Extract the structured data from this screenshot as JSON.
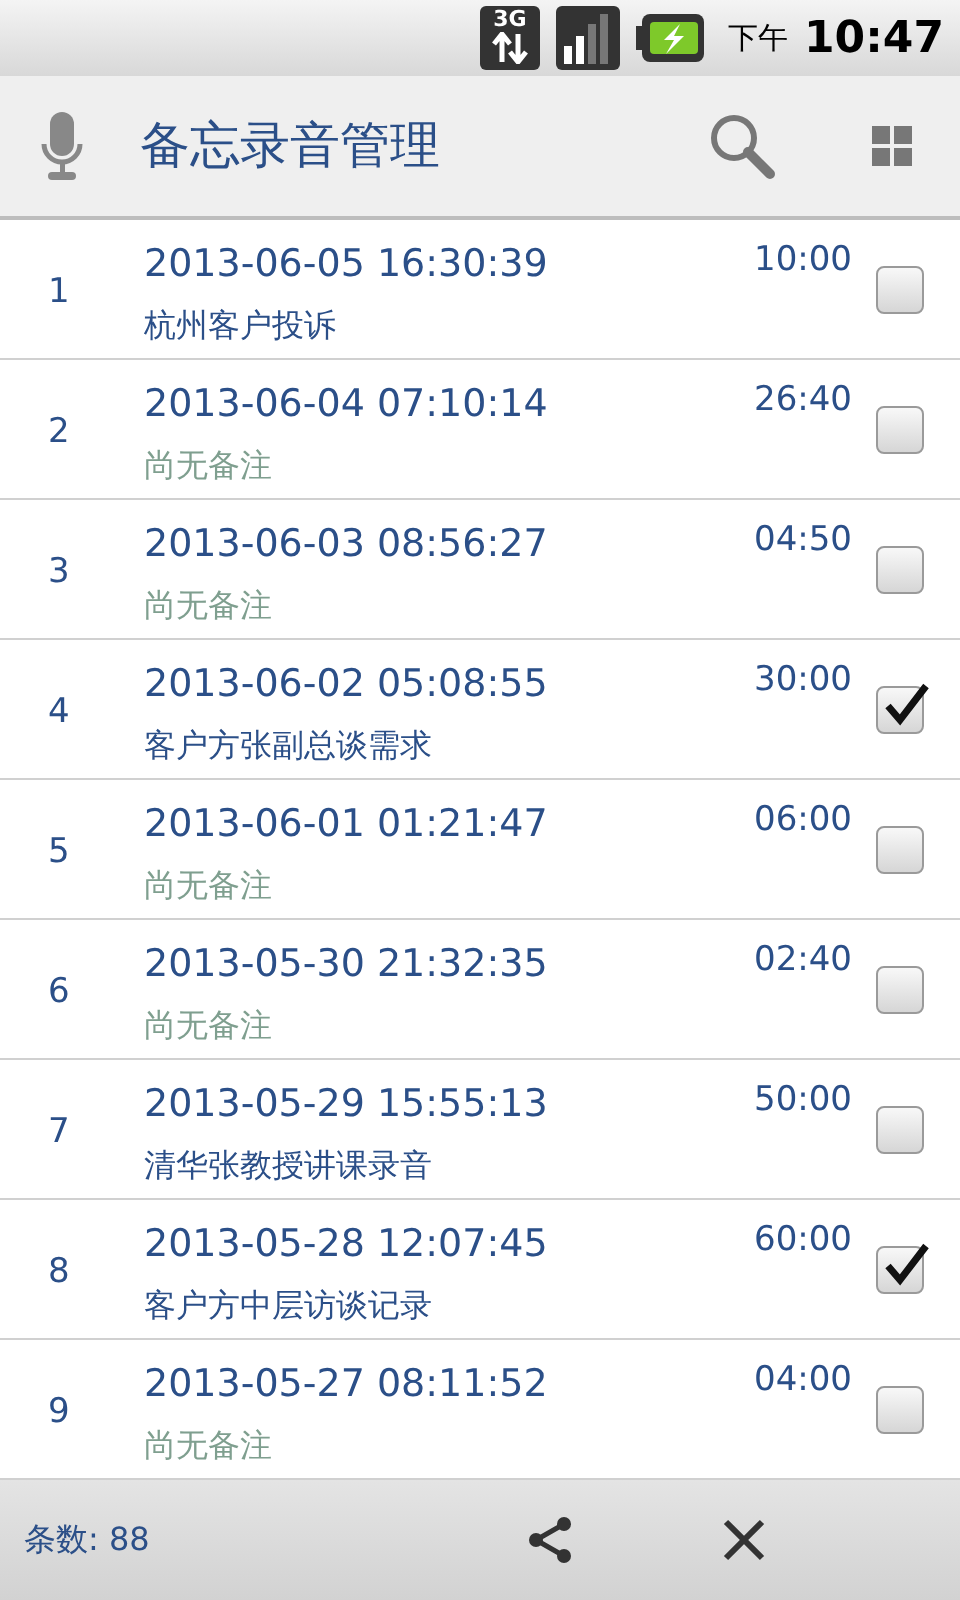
{
  "status_bar": {
    "network": "3G",
    "am_pm": "下午",
    "time": "10:47"
  },
  "app_bar": {
    "title": "备忘录音管理"
  },
  "recordings": [
    {
      "index": "1",
      "datetime": "2013-06-05 16:30:39",
      "note": "杭州客户投诉",
      "has_note": true,
      "duration": "10:00",
      "checked": false
    },
    {
      "index": "2",
      "datetime": "2013-06-04 07:10:14",
      "note": "尚无备注",
      "has_note": false,
      "duration": "26:40",
      "checked": false
    },
    {
      "index": "3",
      "datetime": "2013-06-03 08:56:27",
      "note": "尚无备注",
      "has_note": false,
      "duration": "04:50",
      "checked": false
    },
    {
      "index": "4",
      "datetime": "2013-06-02 05:08:55",
      "note": "客户方张副总谈需求",
      "has_note": true,
      "duration": "30:00",
      "checked": true
    },
    {
      "index": "5",
      "datetime": "2013-06-01 01:21:47",
      "note": "尚无备注",
      "has_note": false,
      "duration": "06:00",
      "checked": false
    },
    {
      "index": "6",
      "datetime": "2013-05-30 21:32:35",
      "note": "尚无备注",
      "has_note": false,
      "duration": "02:40",
      "checked": false
    },
    {
      "index": "7",
      "datetime": "2013-05-29 15:55:13",
      "note": "清华张教授讲课录音",
      "has_note": true,
      "duration": "50:00",
      "checked": false
    },
    {
      "index": "8",
      "datetime": "2013-05-28 12:07:45",
      "note": "客户方中层访谈记录",
      "has_note": true,
      "duration": "60:00",
      "checked": true
    },
    {
      "index": "9",
      "datetime": "2013-05-27 08:11:52",
      "note": "尚无备注",
      "has_note": false,
      "duration": "04:00",
      "checked": false
    }
  ],
  "footer": {
    "count": "条数: 88"
  }
}
